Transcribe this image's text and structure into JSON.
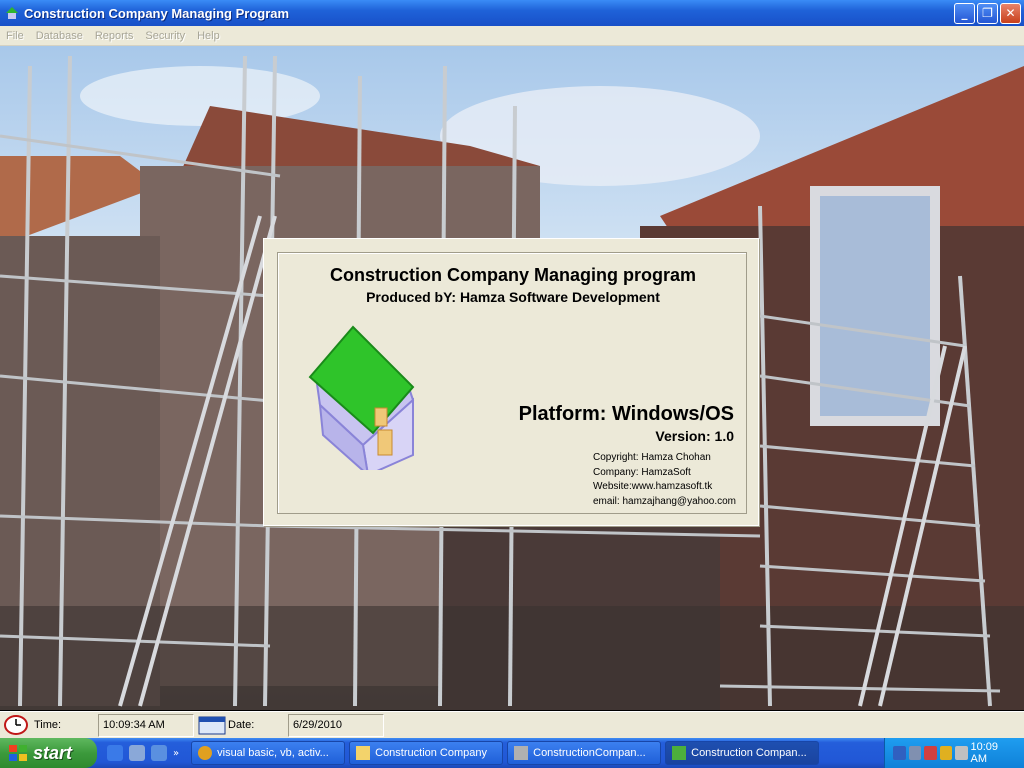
{
  "window": {
    "title": "Construction Company Managing Program",
    "minimize": "_",
    "maximize": "❐",
    "close": "✕"
  },
  "menu": [
    "File",
    "Database",
    "Reports",
    "Security",
    "Help"
  ],
  "splash": {
    "app_title": "Construction Company Managing program",
    "producer": "Produced bY: Hamza Software Development",
    "platform": "Platform: Windows/OS",
    "version": "Version: 1.0",
    "copyright": "Copyright: Hamza Chohan",
    "company": "Company: HamzaSoft",
    "website": "Website:www.hamzasoft.tk",
    "email": "email: hamzajhang@yahoo.com"
  },
  "status": {
    "time_label": "Time:",
    "time_value": "10:09:34 AM",
    "date_label": "Date:",
    "date_value": "6/29/2010"
  },
  "taskbar": {
    "start_label": "start",
    "tasks": [
      {
        "label": "visual basic, vb, activ...",
        "icon_color": "#e0a020"
      },
      {
        "label": "Construction Company",
        "icon_color": "#f3d36b"
      },
      {
        "label": "ConstructionCompan...",
        "icon_color": "#b0b0b0"
      },
      {
        "label": "Construction Compan...",
        "icon_color": "#4caf3c"
      }
    ],
    "clock": "10:09 AM"
  }
}
